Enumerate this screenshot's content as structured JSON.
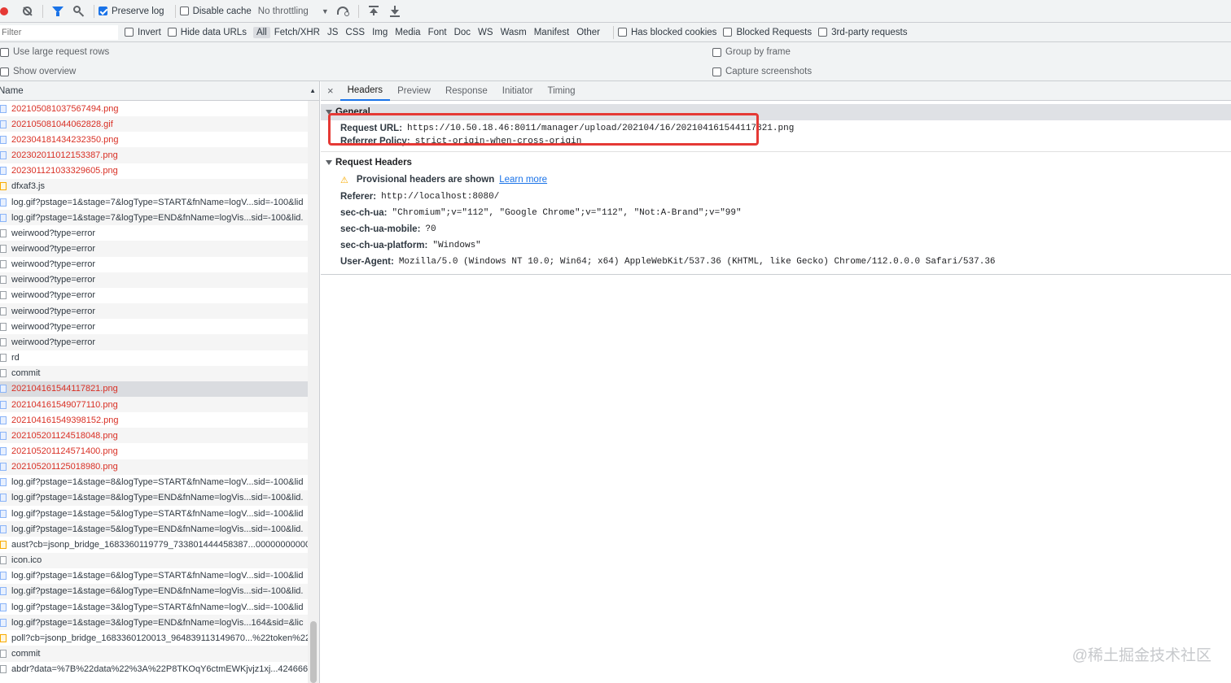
{
  "toolbar": {
    "preserve_log": "Preserve log",
    "disable_cache": "Disable cache",
    "throttling": "No throttling"
  },
  "filterbar": {
    "filter_placeholder": "Filter",
    "invert": "Invert",
    "hide_data_urls": "Hide data URLs",
    "types": [
      "All",
      "Fetch/XHR",
      "JS",
      "CSS",
      "Img",
      "Media",
      "Font",
      "Doc",
      "WS",
      "Wasm",
      "Manifest",
      "Other"
    ],
    "has_blocked_cookies": "Has blocked cookies",
    "blocked_requests": "Blocked Requests",
    "third_party": "3rd-party requests"
  },
  "options": {
    "large_rows": "Use large request rows",
    "show_overview": "Show overview",
    "group_by_frame": "Group by frame",
    "capture_screenshots": "Capture screenshots"
  },
  "list": {
    "header": "Name",
    "rows": [
      {
        "name": "202105081037567494.png",
        "err": true,
        "icon": "img"
      },
      {
        "name": "202105081044062828.gif",
        "err": true,
        "icon": "img"
      },
      {
        "name": "202304181434232350.png",
        "err": true,
        "icon": "img"
      },
      {
        "name": "202302011012153387.png",
        "err": true,
        "icon": "img"
      },
      {
        "name": "202301121033329605.png",
        "err": true,
        "icon": "img"
      },
      {
        "name": "dfxaf3.js",
        "err": false,
        "icon": "js"
      },
      {
        "name": "log.gif?pstage=1&stage=7&logType=START&fnName=logV...sid=-100&lid",
        "err": false,
        "icon": "img"
      },
      {
        "name": "log.gif?pstage=1&stage=7&logType=END&fnName=logVis...sid=-100&lid.",
        "err": false,
        "icon": "img"
      },
      {
        "name": "weirwood?type=error",
        "err": false,
        "icon": "doc"
      },
      {
        "name": "weirwood?type=error",
        "err": false,
        "icon": "doc"
      },
      {
        "name": "weirwood?type=error",
        "err": false,
        "icon": "doc"
      },
      {
        "name": "weirwood?type=error",
        "err": false,
        "icon": "doc"
      },
      {
        "name": "weirwood?type=error",
        "err": false,
        "icon": "doc"
      },
      {
        "name": "weirwood?type=error",
        "err": false,
        "icon": "doc"
      },
      {
        "name": "weirwood?type=error",
        "err": false,
        "icon": "doc"
      },
      {
        "name": "weirwood?type=error",
        "err": false,
        "icon": "doc"
      },
      {
        "name": "rd",
        "err": false,
        "icon": "doc"
      },
      {
        "name": "commit",
        "err": false,
        "icon": "doc"
      },
      {
        "name": "202104161544117821.png",
        "err": true,
        "icon": "img",
        "sel": true
      },
      {
        "name": "202104161549077110.png",
        "err": true,
        "icon": "img"
      },
      {
        "name": "202104161549398152.png",
        "err": true,
        "icon": "img"
      },
      {
        "name": "202105201124518048.png",
        "err": true,
        "icon": "img"
      },
      {
        "name": "202105201124571400.png",
        "err": true,
        "icon": "img"
      },
      {
        "name": "202105201125018980.png",
        "err": true,
        "icon": "img"
      },
      {
        "name": "log.gif?pstage=1&stage=8&logType=START&fnName=logV...sid=-100&lid",
        "err": false,
        "icon": "img"
      },
      {
        "name": "log.gif?pstage=1&stage=8&logType=END&fnName=logVis...sid=-100&lid.",
        "err": false,
        "icon": "img"
      },
      {
        "name": "log.gif?pstage=1&stage=5&logType=START&fnName=logV...sid=-100&lid",
        "err": false,
        "icon": "img"
      },
      {
        "name": "log.gif?pstage=1&stage=5&logType=END&fnName=logVis...sid=-100&lid.",
        "err": false,
        "icon": "img"
      },
      {
        "name": "aust?cb=jsonp_bridge_1683360119779_733801444458387...000000000000C",
        "err": false,
        "icon": "js"
      },
      {
        "name": "icon.ico",
        "err": false,
        "icon": "doc"
      },
      {
        "name": "log.gif?pstage=1&stage=6&logType=START&fnName=logV...sid=-100&lid",
        "err": false,
        "icon": "img"
      },
      {
        "name": "log.gif?pstage=1&stage=6&logType=END&fnName=logVis...sid=-100&lid.",
        "err": false,
        "icon": "img"
      },
      {
        "name": "log.gif?pstage=1&stage=3&logType=START&fnName=logV...sid=-100&lid",
        "err": false,
        "icon": "img"
      },
      {
        "name": "log.gif?pstage=1&stage=3&logType=END&fnName=logVis...164&sid=&lic",
        "err": false,
        "icon": "img"
      },
      {
        "name": "poll?cb=jsonp_bridge_1683360120013_964839113149670...%22token%22%",
        "err": false,
        "icon": "js"
      },
      {
        "name": "commit",
        "err": false,
        "icon": "doc"
      },
      {
        "name": "abdr?data=%7B%22data%22%3A%22P8TKOqY6ctmEWKjvjz1xj...424666%22,",
        "err": false,
        "icon": "doc"
      }
    ]
  },
  "details": {
    "tabs": [
      "Headers",
      "Preview",
      "Response",
      "Initiator",
      "Timing"
    ],
    "general_title": "General",
    "request_url_key": "Request URL:",
    "request_url": "https://10.50.18.46:8011/manager/upload/202104/16/202104161544117821.png",
    "referrer_key": "Referrer Policy:",
    "referrer": "strict-origin-when-cross-origin",
    "req_headers_title": "Request Headers",
    "provisional": "Provisional headers are shown",
    "learn_more": "Learn more",
    "headers": [
      {
        "k": "Referer:",
        "v": "http://localhost:8080/"
      },
      {
        "k": "sec-ch-ua:",
        "v": "\"Chromium\";v=\"112\", \"Google Chrome\";v=\"112\", \"Not:A-Brand\";v=\"99\""
      },
      {
        "k": "sec-ch-ua-mobile:",
        "v": "?0"
      },
      {
        "k": "sec-ch-ua-platform:",
        "v": "\"Windows\""
      },
      {
        "k": "User-Agent:",
        "v": "Mozilla/5.0 (Windows NT 10.0; Win64; x64) AppleWebKit/537.36 (KHTML, like Gecko) Chrome/112.0.0.0 Safari/537.36"
      }
    ]
  },
  "watermark": "@稀土掘金技术社区",
  "colors": {
    "accent": "#1a73e8",
    "error": "#d93025",
    "record": "#e53935"
  }
}
